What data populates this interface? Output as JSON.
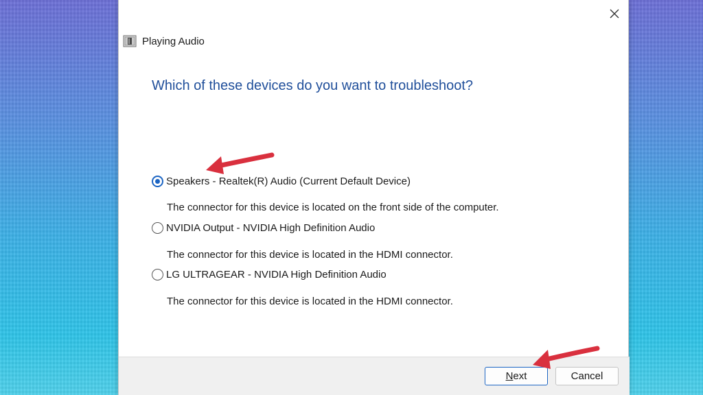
{
  "dialog": {
    "title": "Playing Audio",
    "heading": "Which of these devices do you want to troubleshoot?",
    "options": [
      {
        "label": "Speakers - Realtek(R) Audio (Current Default Device)",
        "description": "The connector for this device is located on the front side of the computer.",
        "checked": true
      },
      {
        "label": "NVIDIA Output - NVIDIA High Definition Audio",
        "description": "The connector for this device is located in the HDMI connector.",
        "checked": false
      },
      {
        "label": "LG ULTRAGEAR - NVIDIA High Definition Audio",
        "description": "The connector for this device is located in the HDMI connector.",
        "checked": false
      }
    ],
    "buttons": {
      "next_mnemonic": "N",
      "next_rest": "ext",
      "cancel": "Cancel"
    }
  },
  "icons": {
    "close": "close-icon",
    "app": "audio-troubleshooter-icon",
    "annotation": "red-arrow-icon"
  },
  "colors": {
    "heading": "#1f4e9a",
    "radio_selected": "#1b64c3",
    "annotation_arrow": "#d9303e"
  }
}
